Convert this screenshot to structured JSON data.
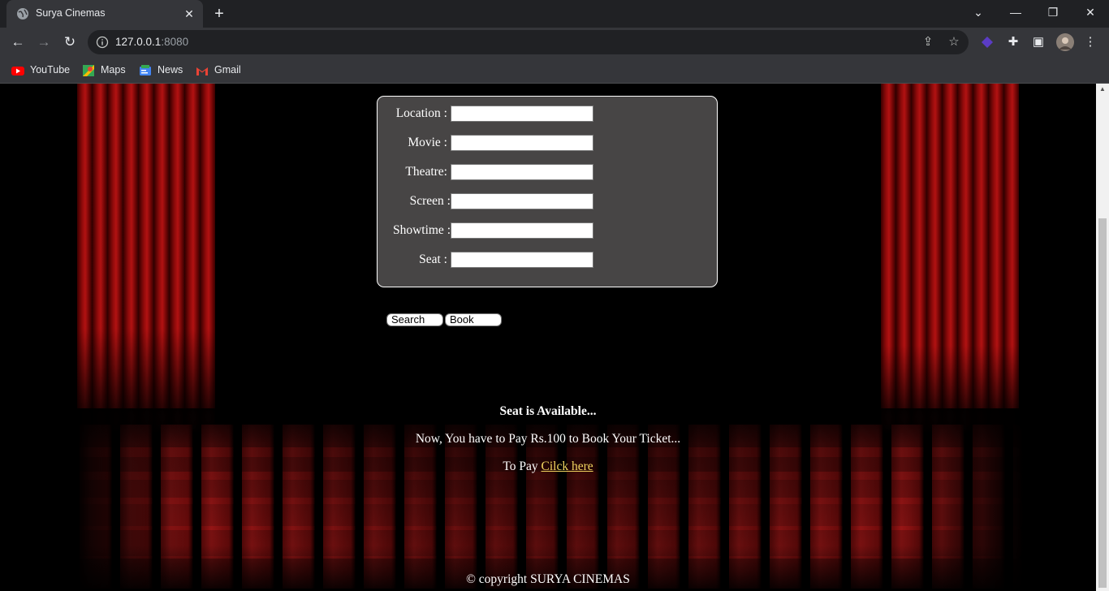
{
  "browser": {
    "tab_title": "Surya Cinemas",
    "url_host": "127.0.0.1",
    "url_port": ":8080",
    "bookmarks": [
      {
        "label": "YouTube",
        "icon": "youtube-icon"
      },
      {
        "label": "Maps",
        "icon": "maps-icon"
      },
      {
        "label": "News",
        "icon": "news-icon"
      },
      {
        "label": "Gmail",
        "icon": "gmail-icon"
      }
    ]
  },
  "form": {
    "fields": [
      {
        "label": "Location :",
        "value": ""
      },
      {
        "label": "Movie :",
        "value": ""
      },
      {
        "label": "Theatre:",
        "value": ""
      },
      {
        "label": "Screen :",
        "value": ""
      },
      {
        "label": "Showtime :",
        "value": ""
      },
      {
        "label": "Seat :",
        "value": ""
      }
    ],
    "search_label": "Search",
    "book_label": "Book"
  },
  "result": {
    "status": "Seat is Available...",
    "message": "Now, You have to Pay Rs.100 to Book Your Ticket...",
    "pay_prefix": "To Pay",
    "pay_link": "Cilck here"
  },
  "footer": {
    "copyright": "© copyright SURYA CINEMAS"
  },
  "colors": {
    "panel_bg": "#474545",
    "link": "#f2d560",
    "curtain": "#8d0a0a"
  }
}
